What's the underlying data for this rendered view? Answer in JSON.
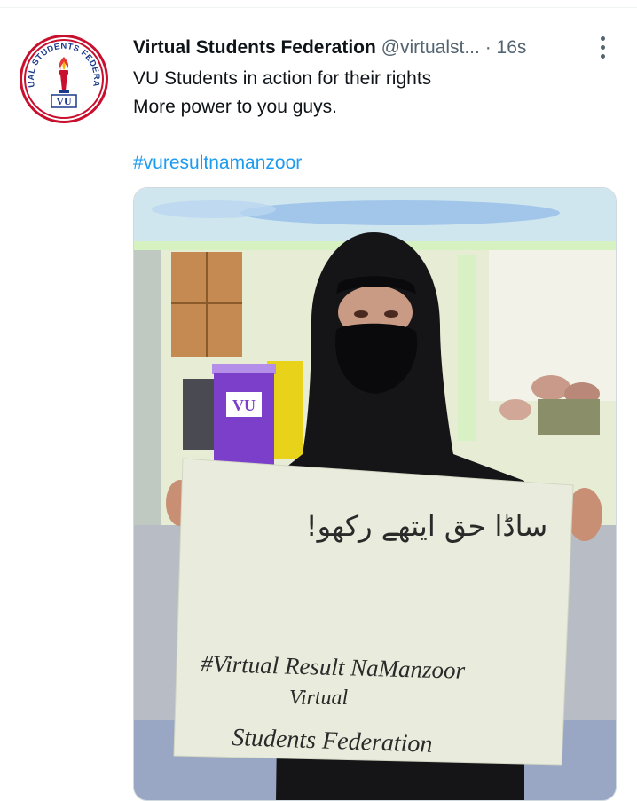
{
  "tweet": {
    "display_name": "Virtual Students Federation",
    "handle": "@virtualst...",
    "separator": "·",
    "time": "16s",
    "text_lines": [
      "VU Students in action for their rights",
      "More power to you guys."
    ],
    "hashtag": "#vuresultnamanzoor"
  },
  "avatar": {
    "arc_text": "VIRTUAL STUDENTS FEDERATION",
    "badge": "VU"
  },
  "photo": {
    "sign_urdu": "ساڈا حق ایتھے رکھو!",
    "sign_line1": "#Virtual Result NaManzoor",
    "sign_line2": "Virtual",
    "sign_line3": "Students Federation",
    "podium_badge": "VU"
  },
  "colors": {
    "link": "#1d9bf0",
    "secondary_text": "#536471",
    "avatar_ring": "#c8102e",
    "avatar_text": "#1b3a8c"
  }
}
